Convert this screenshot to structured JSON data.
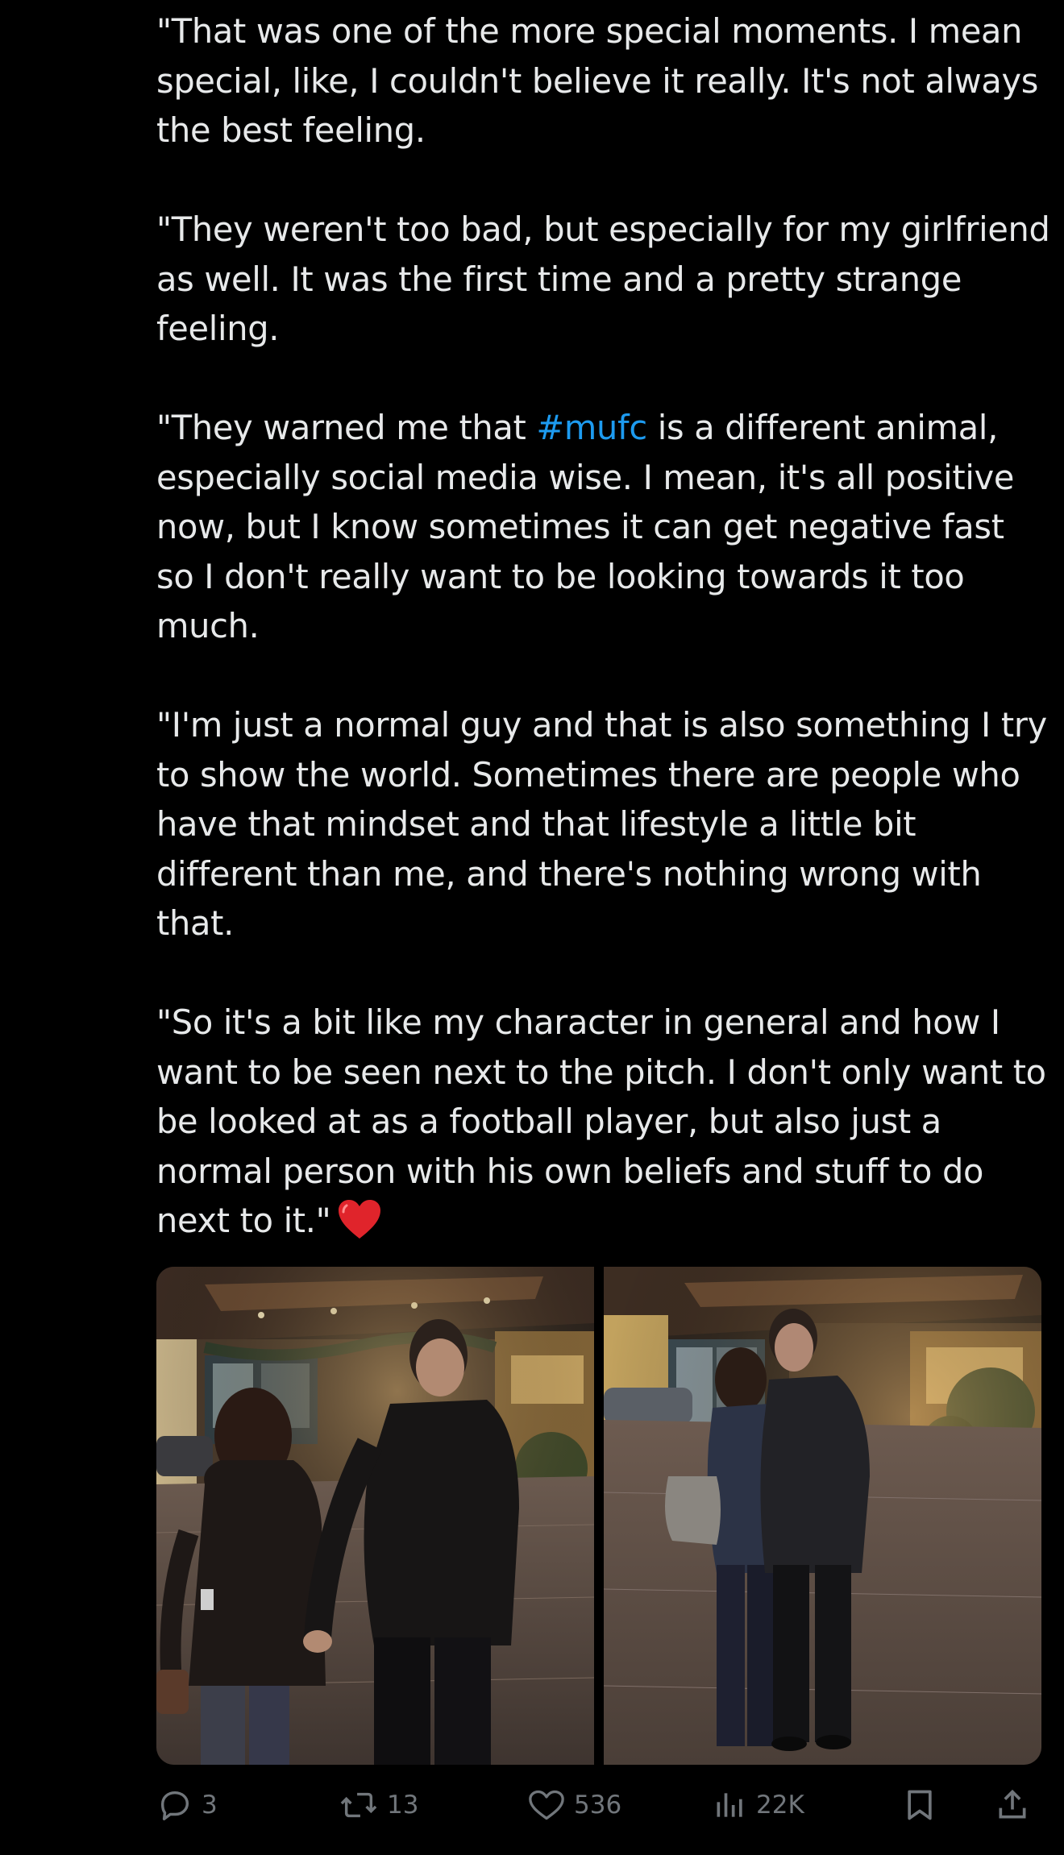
{
  "tweet": {
    "paragraphs": [
      "\"That was one of the more special moments. I mean special, like, I couldn't believe it really. It's not always the best feeling.",
      "\"They weren't too bad, but especially for my girlfriend as well. It was the first time and a pretty strange feeling."
    ],
    "p3_before": "\"They warned me that ",
    "p3_hashtag": "#mufc",
    "p3_after": " is a different animal, especially social media wise. I mean, it's all positive now, but I know sometimes it can get negative fast so I don't really want to be looking towards it too much.",
    "p4": "\"I'm just a normal guy and that is also something I try to show the world. Sometimes there are people who have that mindset and that lifestyle a little bit different than me, and there's nothing wrong with that.",
    "p5": "\"So it's a bit like my character in general and how I want to be seen next to the pitch. I don't only want to be looked at as a football player, but also just a normal person with his own beliefs and stuff to do next to it.\"",
    "emoji_icon": "red-heart-emoji",
    "hashtag_color": "#1d9bf0"
  },
  "actions": {
    "replies": "3",
    "reposts": "13",
    "likes": "536",
    "views": "22K"
  },
  "colors": {
    "background": "#000000",
    "text": "#e7e9ea",
    "muted": "#71767b"
  }
}
